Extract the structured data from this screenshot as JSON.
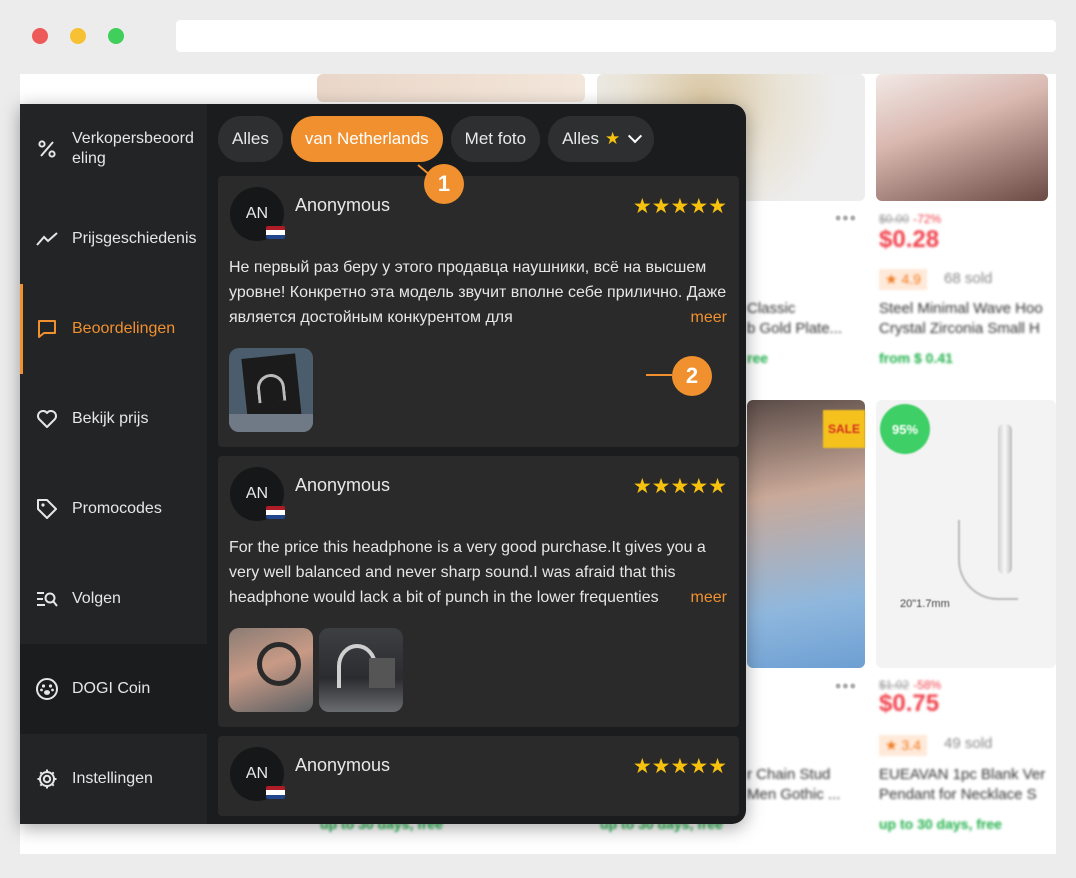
{
  "browser": {
    "dots": [
      "#ee5a5a",
      "#f6c234",
      "#3fcf5a"
    ]
  },
  "background_page": {
    "products": [
      {
        "old": "$0.00",
        "disc": "-72%",
        "price": "$0.28",
        "rating": "★ 4.9",
        "sold": "68 sold",
        "title1": "Steel Minimal Wave Hoo",
        "title2": "Crystal Zirconia Small H",
        "ship": "from $ 0.41"
      },
      {
        "old": "$1.02",
        "disc": "-58%",
        "price": "$0.75",
        "rating": "★ 3.4",
        "sold": "49 sold",
        "title1": "EUEAVAN 1pc Blank Ver",
        "title2": "Pendant for Necklace S",
        "ship": "up to 30 days, free"
      }
    ],
    "mid_titles": [
      "Classic",
      "b Gold Plate...",
      "ree",
      "r Chain Stud",
      "Men Gothic ...",
      "up to 30 days, free"
    ],
    "sale_tag": "SALE",
    "pct_badge": "95%",
    "dims": "20\"1.7mm"
  },
  "sidebar": {
    "items": [
      {
        "label": "Verkopersbeoordeling",
        "icon": "percent-icon"
      },
      {
        "label": "Prijsgeschiedenis",
        "icon": "trend-line-icon"
      },
      {
        "label": "Beoordelingen",
        "icon": "chat-bubble-icon"
      },
      {
        "label": "Bekijk prijs",
        "icon": "heart-icon"
      },
      {
        "label": "Promocodes",
        "icon": "tag-icon"
      },
      {
        "label": "Volgen",
        "icon": "list-search-icon"
      },
      {
        "label": "DOGI Coin",
        "icon": "paw-icon"
      },
      {
        "label": "Instellingen",
        "icon": "gear-icon"
      }
    ]
  },
  "filters": {
    "all": "Alles",
    "country": "van Netherlands",
    "photo": "Met foto",
    "stars": "Alles"
  },
  "reviews": [
    {
      "initials": "AN",
      "author": "Anonymous",
      "stars": "★★★★★",
      "text": "Не первый раз беру у этого продавца наушники, всё на высшем уровне! Конкретно эта модель звучит вполне себе прилично. Даже является достойным конкурентом для",
      "more": "meer"
    },
    {
      "initials": "AN",
      "author": "Anonymous",
      "stars": "★★★★★",
      "text": "For the price this headphone is a very good purchase.It gives you a very well balanced and never sharp sound.I was afraid that this headphone would lack a bit of punch in the lower frequenties",
      "more": "meer"
    },
    {
      "initials": "AN",
      "author": "Anonymous",
      "stars": "★★★★★"
    }
  ],
  "callouts": [
    "1",
    "2"
  ],
  "colors": {
    "accent": "#f0902f",
    "star": "#f6c20e",
    "panel": "#1a1c1e"
  }
}
